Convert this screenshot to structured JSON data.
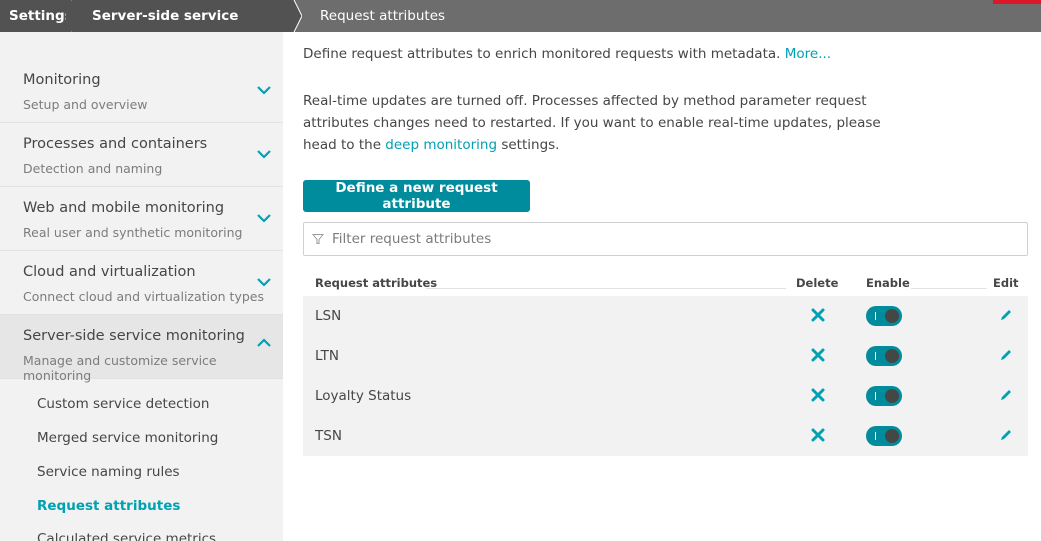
{
  "breadcrumb": {
    "items": [
      "Settings",
      "Server-side service monitoring",
      "Request attributes"
    ]
  },
  "sidebar": {
    "groups": [
      {
        "title": "Monitoring",
        "subtitle": "Setup and overview",
        "expanded": false
      },
      {
        "title": "Processes and containers",
        "subtitle": "Detection and naming",
        "expanded": false
      },
      {
        "title": "Web and mobile monitoring",
        "subtitle": "Real user and synthetic monitoring",
        "expanded": false
      },
      {
        "title": "Cloud and virtualization",
        "subtitle": "Connect cloud and virtualization types",
        "expanded": false
      },
      {
        "title": "Server-side service monitoring",
        "subtitle": "Manage and customize service monitoring",
        "expanded": true
      }
    ],
    "links": [
      "Custom service detection",
      "Merged service monitoring",
      "Service naming rules",
      "Request attributes",
      "Calculated service metrics"
    ],
    "active_link": "Request attributes"
  },
  "main": {
    "intro": "Define request attributes to enrich monitored requests with metadata.",
    "more_link": "More...",
    "notice_pre": "Real-time updates are turned off. Processes affected by method parameter request attributes changes need to restarted. If you want to enable real-time updates, please head to the ",
    "notice_link": "deep monitoring",
    "notice_post": " settings.",
    "define_button": "Define a new request attribute",
    "filter_placeholder": "Filter request attributes",
    "table": {
      "headers": {
        "name": "Request attributes",
        "delete": "Delete",
        "enable": "Enable",
        "edit": "Edit"
      },
      "rows": [
        {
          "name": "LSN",
          "enabled": true
        },
        {
          "name": "LTN",
          "enabled": true
        },
        {
          "name": "Loyalty Status",
          "enabled": true
        },
        {
          "name": "TSN",
          "enabled": true
        }
      ]
    }
  },
  "icons": {
    "group_chevron": "chevron-down-icon",
    "expanded_chevron": "chevron-up-icon",
    "filter": "filter-icon",
    "delete": "close-icon",
    "edit": "pencil-icon"
  },
  "colors": {
    "accent": "#00a1b2",
    "button": "#008c9c",
    "breadcrumb_dark": "#525252",
    "breadcrumb": "#6d6d6d",
    "sidebar_bg": "#f2f2f2"
  }
}
